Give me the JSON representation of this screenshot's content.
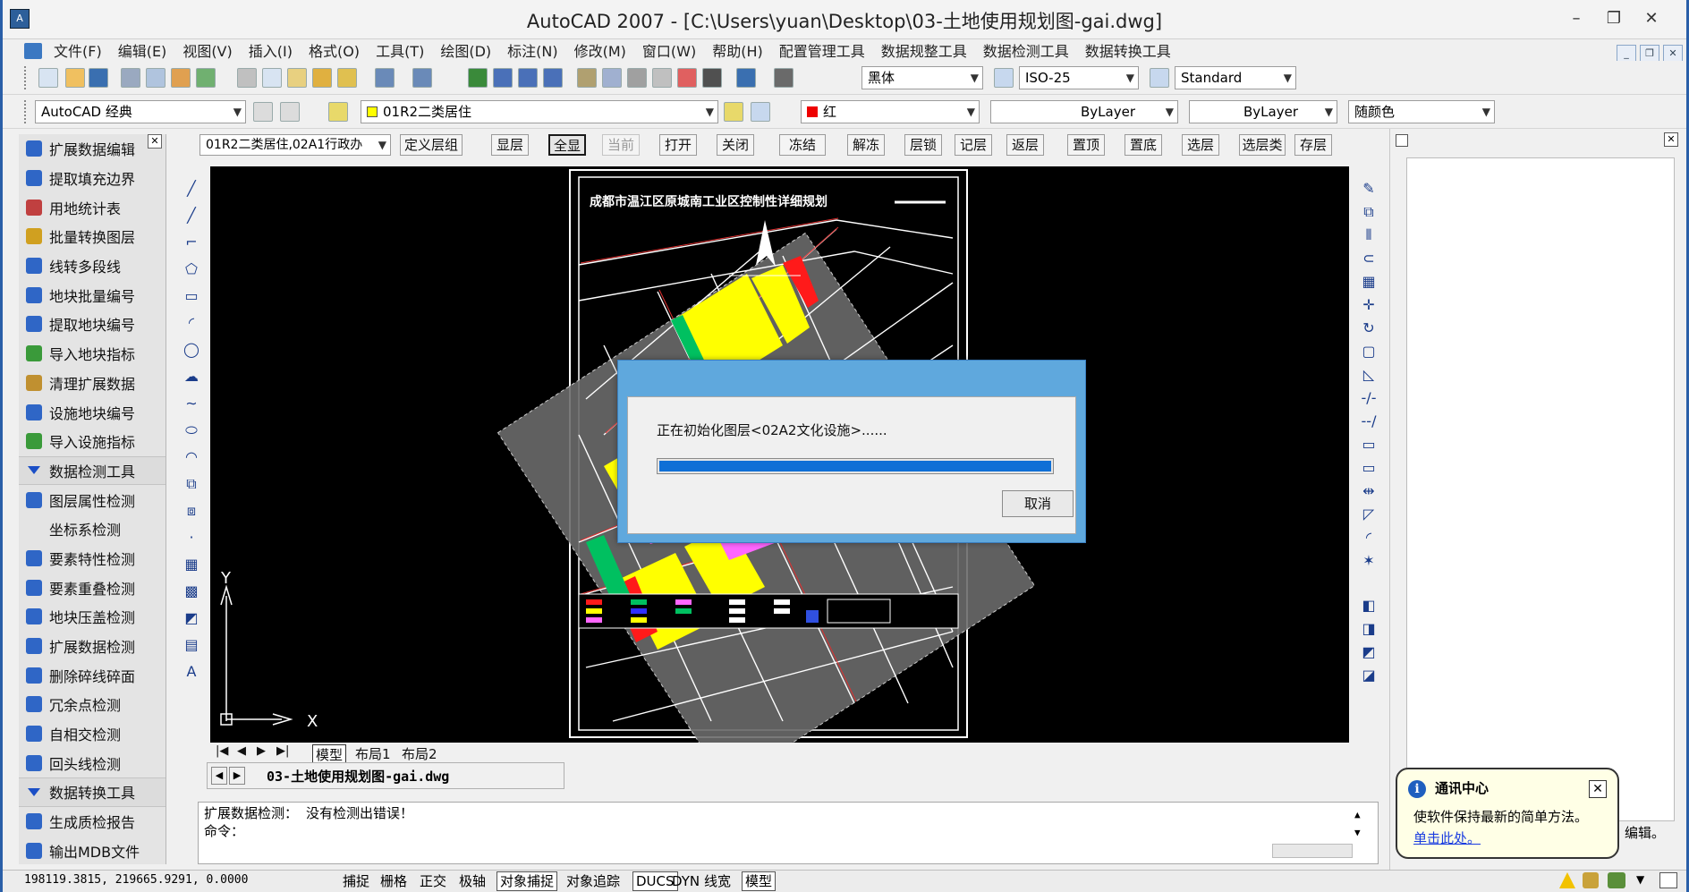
{
  "window": {
    "title": "AutoCAD 2007 - [C:\\Users\\yuan\\Desktop\\03-土地使用规划图-gai.dwg]",
    "minimize": "–",
    "restore": "❐",
    "close": "✕"
  },
  "menubar": {
    "items": [
      "文件(F)",
      "编辑(E)",
      "视图(V)",
      "插入(I)",
      "格式(O)",
      "工具(T)",
      "绘图(D)",
      "标注(N)",
      "修改(M)",
      "窗口(W)",
      "帮助(H)",
      "配置管理工具",
      "数据规整工具",
      "数据检测工具",
      "数据转换工具"
    ]
  },
  "toolbar2": {
    "font_combo": "黑体",
    "dimstyle_combo": "ISO-25",
    "textstyle_combo": "Standard"
  },
  "toolbar3": {
    "workspace_combo": "AutoCAD 经典",
    "layer_combo": "01R2二类居住",
    "color_combo": "红",
    "linetype_combo": "ByLayer",
    "lineweight_combo": "ByLayer",
    "plotstyle_combo": "随颜色"
  },
  "layerbar": {
    "layer_list_combo": "01R2二类居住,02A1行政办",
    "buttons": [
      "定义层组",
      "显层",
      "全显",
      "当前",
      "打开",
      "关闭",
      "冻结",
      "解冻",
      "层锁",
      "记层",
      "返层",
      "置顶",
      "置底",
      "选层",
      "选层类",
      "存层"
    ]
  },
  "palette": {
    "items_top": [
      "扩展数据编辑",
      "提取填充边界",
      "用地统计表",
      "批量转换图层",
      "线转多段线",
      "地块批量编号",
      "提取地块编号",
      "导入地块指标",
      "清理扩展数据",
      "设施地块编号",
      "导入设施指标"
    ],
    "header_check": "数据检测工具",
    "items_check": [
      "图层属性检测",
      "坐标系检测",
      "要素特性检测",
      "要素重叠检测",
      "地块压盖检测",
      "扩展数据检测",
      "删除碎线碎面",
      "冗余点检测",
      "自相交检测",
      "回头线检测"
    ],
    "header_convert": "数据转换工具",
    "items_convert": [
      "生成质检报告",
      "输出MDB文件"
    ]
  },
  "drawing": {
    "map_title": "成都市温江区原城南工业区控制性详细规划",
    "axis_y": "Y",
    "axis_x": "X"
  },
  "layout_tabs": {
    "model": "模型",
    "layout1": "布局1",
    "layout2": "布局2"
  },
  "doc_tab": "03-土地使用规划图-gai.dwg",
  "command": {
    "line1": " 扩展数据检测： 没有检测出错误！",
    "line2": "命令："
  },
  "dialog": {
    "message": "正在初始化图层<02A2文化设施>......",
    "progress": 1.0,
    "cancel_label": "取消"
  },
  "balloon": {
    "title": "通讯中心",
    "text": "使软件保持最新的简单方法。",
    "link": "单击此处。",
    "close": "✕",
    "info": "i"
  },
  "right_panel": {
    "edit_label": "编辑。"
  },
  "statusbar": {
    "coords": "198119.3815, 219665.9291, 0.0000",
    "toggles": [
      {
        "label": "捕捉",
        "on": false
      },
      {
        "label": "栅格",
        "on": false
      },
      {
        "label": "正交",
        "on": false
      },
      {
        "label": "极轴",
        "on": false
      },
      {
        "label": "对象捕捉",
        "on": true
      },
      {
        "label": "对象追踪",
        "on": false
      },
      {
        "label": "DUCS",
        "on": true
      },
      {
        "label": "DYN",
        "on": false
      },
      {
        "label": "线宽",
        "on": false
      },
      {
        "label": "模型",
        "on": true
      }
    ]
  },
  "colors": {
    "accent_blue": "#0f6fd6",
    "dialog_frame": "#5fa8dd",
    "balloon_bg": "#ffffe6",
    "canvas_bg": "#000000"
  }
}
